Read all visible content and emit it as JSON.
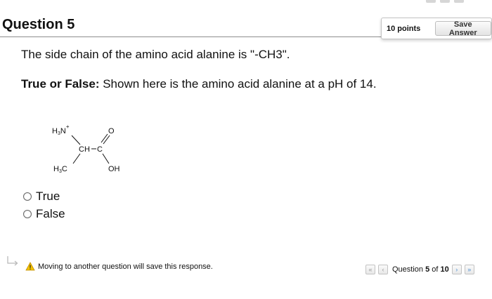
{
  "question": {
    "title": "Question 5",
    "points": "10 points",
    "save_label": "Save Answer",
    "statement": "The side chain of the amino acid alanine is \"-CH3\".",
    "prompt_bold": "True or False:",
    "prompt_rest": " Shown here is the amino acid alanine at a pH of 14."
  },
  "molecule": {
    "labels": [
      "H3N+",
      "O",
      "CH",
      "C",
      "H3C",
      "OH"
    ]
  },
  "options": [
    {
      "label": "True",
      "selected": false
    },
    {
      "label": "False",
      "selected": false
    }
  ],
  "footer": {
    "warning": "Moving to another question will save this response.",
    "pager_prefix": "Question",
    "current": "5",
    "of": "of",
    "total": "10"
  },
  "icons": {
    "warning": "warning-triangle-icon",
    "first": "double-chevron-left-icon",
    "prev": "chevron-left-icon",
    "next": "chevron-right-icon",
    "last": "double-chevron-right-icon",
    "hint": "return-arrow-icon"
  },
  "colors": {
    "warning": "#f3c300",
    "nav_active": "#4d8fd1"
  }
}
